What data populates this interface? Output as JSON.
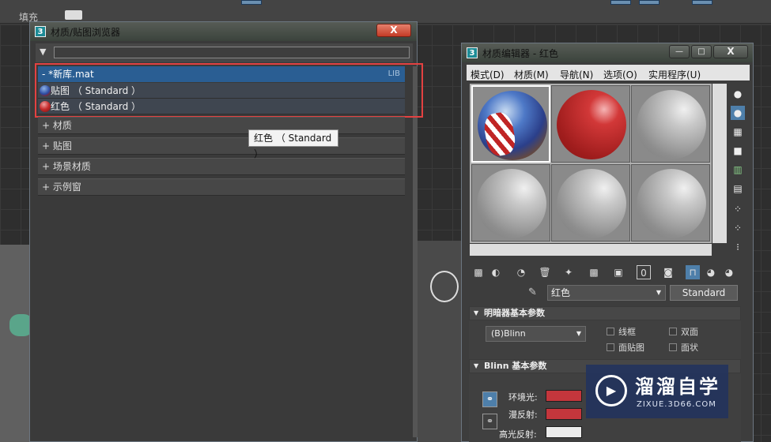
{
  "toolbar": {
    "fill_label": "填充"
  },
  "browser": {
    "title": "材质/贴图浏览器",
    "close": "X",
    "library": {
      "name": "- *新库.mat",
      "tag": "LIB",
      "items": [
        {
          "label": "贴图 （ Standard ）"
        },
        {
          "label": "红色 （ Standard ）"
        }
      ]
    },
    "groups": [
      {
        "label": "+ 材质"
      },
      {
        "label": "+ 贴图"
      },
      {
        "label": "+ 场景材质"
      },
      {
        "label": "+ 示例窗"
      }
    ],
    "tooltip": "红色 （ Standard ）"
  },
  "editor": {
    "title": "材质编辑器 - 红色",
    "menu": [
      "模式(D)",
      "材质(M)",
      "导航(N)",
      "选项(O)",
      "实用程序(U)"
    ],
    "material_name": "红色",
    "material_type": "Standard",
    "shader_rollout": {
      "title": "明暗器基本参数",
      "shader": "(B)Blinn",
      "options": [
        "线框",
        "双面",
        "面贴图",
        "面状"
      ]
    },
    "blinn_rollout": {
      "title": "Blinn 基本参数",
      "rows": [
        {
          "label": "环境光:",
          "color": "#c4363c"
        },
        {
          "label": "漫反射:",
          "color": "#c4363c"
        },
        {
          "label": "高光反射:",
          "color": "#ececec"
        }
      ]
    }
  },
  "watermark": {
    "brand": "溜溜自学",
    "url": "ZIXUE.3D66.COM"
  },
  "colors": {
    "accent": "#2a5e93",
    "highlight": "#e34141"
  }
}
